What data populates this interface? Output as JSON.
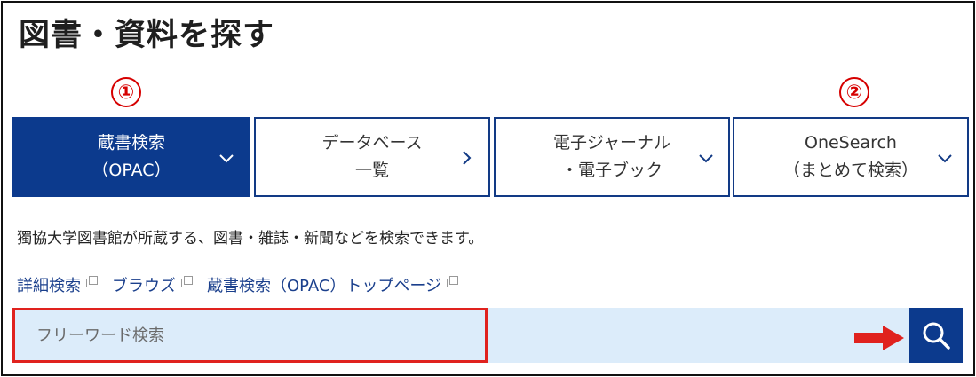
{
  "header": {
    "title": "図書・資料を探す"
  },
  "annotations": {
    "marker_1": "①",
    "marker_2": "②",
    "highlight_color": "#e0221e"
  },
  "tabs": [
    {
      "line1": "蔵書検索",
      "line2": "（OPAC）",
      "indicator": "chevron-down-icon",
      "active": true
    },
    {
      "line1": "データベース",
      "line2": "一覧",
      "indicator": "chevron-right-icon",
      "active": false
    },
    {
      "line1": "電子ジャーナル",
      "line2": "・電子ブック",
      "indicator": "chevron-down-icon",
      "active": false
    },
    {
      "line1": "OneSearch",
      "line2": "（まとめて検索）",
      "indicator": "chevron-down-icon",
      "active": false
    }
  ],
  "content": {
    "description": "獨協大学図書館が所蔵する、図書・雑誌・新聞などを検索できます。",
    "links": [
      {
        "label": "詳細検索",
        "icon": "external-link-icon"
      },
      {
        "label": "ブラウズ",
        "icon": "external-link-icon"
      },
      {
        "label": "蔵書検索（OPAC）トップページ",
        "icon": "external-link-icon"
      }
    ]
  },
  "search": {
    "placeholder": "フリーワード検索",
    "value": "",
    "button_icon": "search-icon"
  },
  "colors": {
    "primary": "#0c3a8d",
    "search_bg": "#dcecfa",
    "link": "#1a3f8c",
    "annotation": "#e0221e"
  }
}
